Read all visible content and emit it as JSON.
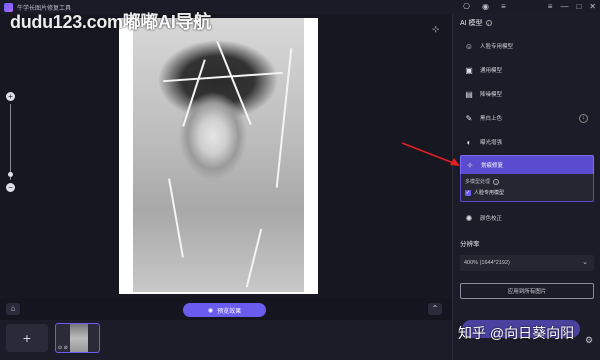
{
  "titlebar": {
    "app_title": "牛学长图片修复工具",
    "watermark": "dudu123.com嘟嘟AI导航"
  },
  "panel": {
    "section_title": "AI 模型",
    "models": [
      {
        "label": "人脸专用模型",
        "icon": "face-icon"
      },
      {
        "label": "通用模型",
        "icon": "image-icon"
      },
      {
        "label": "降噪模型",
        "icon": "denoise-icon"
      },
      {
        "label": "黑白上色",
        "icon": "colorize-icon"
      },
      {
        "label": "曝光增强",
        "icon": "exposure-icon"
      },
      {
        "label": "划痕修复",
        "icon": "scratch-repair-icon"
      },
      {
        "label": "颜色校正",
        "icon": "color-correct-icon"
      }
    ],
    "sub_title": "多模型处理",
    "sub_option": "人脸专用模型",
    "resolution_label": "分辨率",
    "resolution_value": "400% (1644*2192)",
    "apply_all": "应用到所有图片"
  },
  "canvas": {
    "preview_label": "预览效果"
  },
  "overlay": {
    "zhihu_mark": "知乎 @向日葵向阳"
  },
  "colors": {
    "accent": "#6b5cf0",
    "background": "#15151f",
    "panel": "#1c1c28",
    "annotation_arrow": "#e02020"
  }
}
